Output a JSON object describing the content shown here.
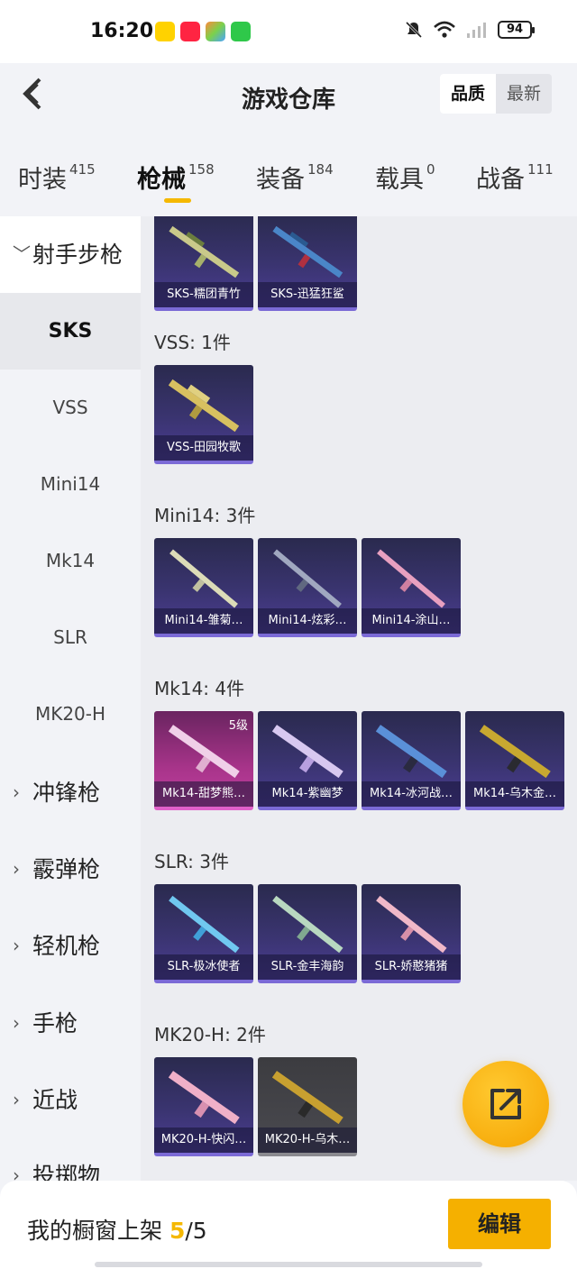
{
  "status_bar": {
    "time": "16:20",
    "battery": "94"
  },
  "header": {
    "title": "游戏仓库",
    "sort_options": [
      "品质",
      "最新"
    ]
  },
  "tabs": [
    {
      "label": "时装",
      "count": "415"
    },
    {
      "label": "枪械",
      "count": "158",
      "active": true
    },
    {
      "label": "装备",
      "count": "184"
    },
    {
      "label": "载具",
      "count": "0"
    },
    {
      "label": "战备",
      "count": "111"
    }
  ],
  "sidebar": {
    "category_open": "射手步枪",
    "sub_items": [
      "SKS",
      "VSS",
      "Mini14",
      "Mk14",
      "SLR",
      "MK20-H"
    ],
    "selected": "SKS",
    "categories": [
      "冲锋枪",
      "霰弹枪",
      "轻机枪",
      "手枪",
      "近战",
      "投掷物"
    ]
  },
  "groups": {
    "sks": {
      "items": [
        "SKS-糯团青竹",
        "SKS-迅猛狂鲨"
      ]
    },
    "vss": {
      "title": "VSS: 1件",
      "items": [
        "VSS-田园牧歌"
      ]
    },
    "mini14": {
      "title": "Mini14: 3件",
      "items": [
        "Mini14-雏菊…",
        "Mini14-炫彩…",
        "Mini14-涂山…"
      ]
    },
    "mk14": {
      "title": "Mk14: 4件",
      "items": [
        "Mk14-甜梦熊…",
        "Mk14-紫幽梦",
        "Mk14-冰河战…",
        "Mk14-乌木金…"
      ],
      "level_badge": "5级"
    },
    "slr": {
      "title": "SLR: 3件",
      "items": [
        "SLR-极冰使者",
        "SLR-金丰海韵",
        "SLR-娇憨猪猪"
      ]
    },
    "mk20h": {
      "title": "MK20-H: 2件",
      "items": [
        "MK20-H-快闪…",
        "MK20-H-乌木…"
      ]
    }
  },
  "bottom_bar": {
    "label": "我的橱窗上架 ",
    "current": "5",
    "separator": "/",
    "total": "5",
    "edit_label": "编辑"
  },
  "colors": {
    "accent": "#f5b800",
    "card_purple": "#4b3d93",
    "card_pink": "#c040a0"
  }
}
